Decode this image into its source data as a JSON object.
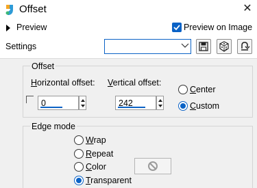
{
  "window": {
    "title": "Offset",
    "close_glyph": "✕"
  },
  "preview": {
    "label": "Preview",
    "expanded": false,
    "preview_on_image_label": "Preview on Image",
    "preview_on_image_checked": true
  },
  "settings": {
    "label": "Settings",
    "value": ""
  },
  "offset": {
    "legend": "Offset",
    "horizontal": {
      "label_prefix": "H",
      "label_rest": "orizontal offset:",
      "value": "0"
    },
    "vertical": {
      "label_prefix": "V",
      "label_rest": "ertical offset:",
      "value": "242"
    },
    "center": {
      "label_prefix": "C",
      "label_rest": "enter",
      "selected": false
    },
    "custom": {
      "label_prefix": "C",
      "label_rest": "ustom",
      "selected": true
    }
  },
  "edge_mode": {
    "legend": "Edge mode",
    "options": [
      {
        "prefix": "W",
        "rest": "rap",
        "selected": false
      },
      {
        "prefix": "R",
        "rest": "epeat",
        "selected": false
      },
      {
        "prefix": "C",
        "rest": "olor",
        "selected": false
      },
      {
        "prefix": "T",
        "rest": "ransparent",
        "selected": true
      }
    ]
  },
  "colors": {
    "accent": "#0a62c6",
    "panel": "#f0f0f0",
    "border": "#d4d4d4"
  },
  "icons": [
    "app-icon",
    "close-icon",
    "chevron-right-icon",
    "checkbox-checked-icon",
    "chevron-down-icon",
    "save-icon",
    "dice-icon",
    "reset-icon",
    "no-color-icon"
  ]
}
